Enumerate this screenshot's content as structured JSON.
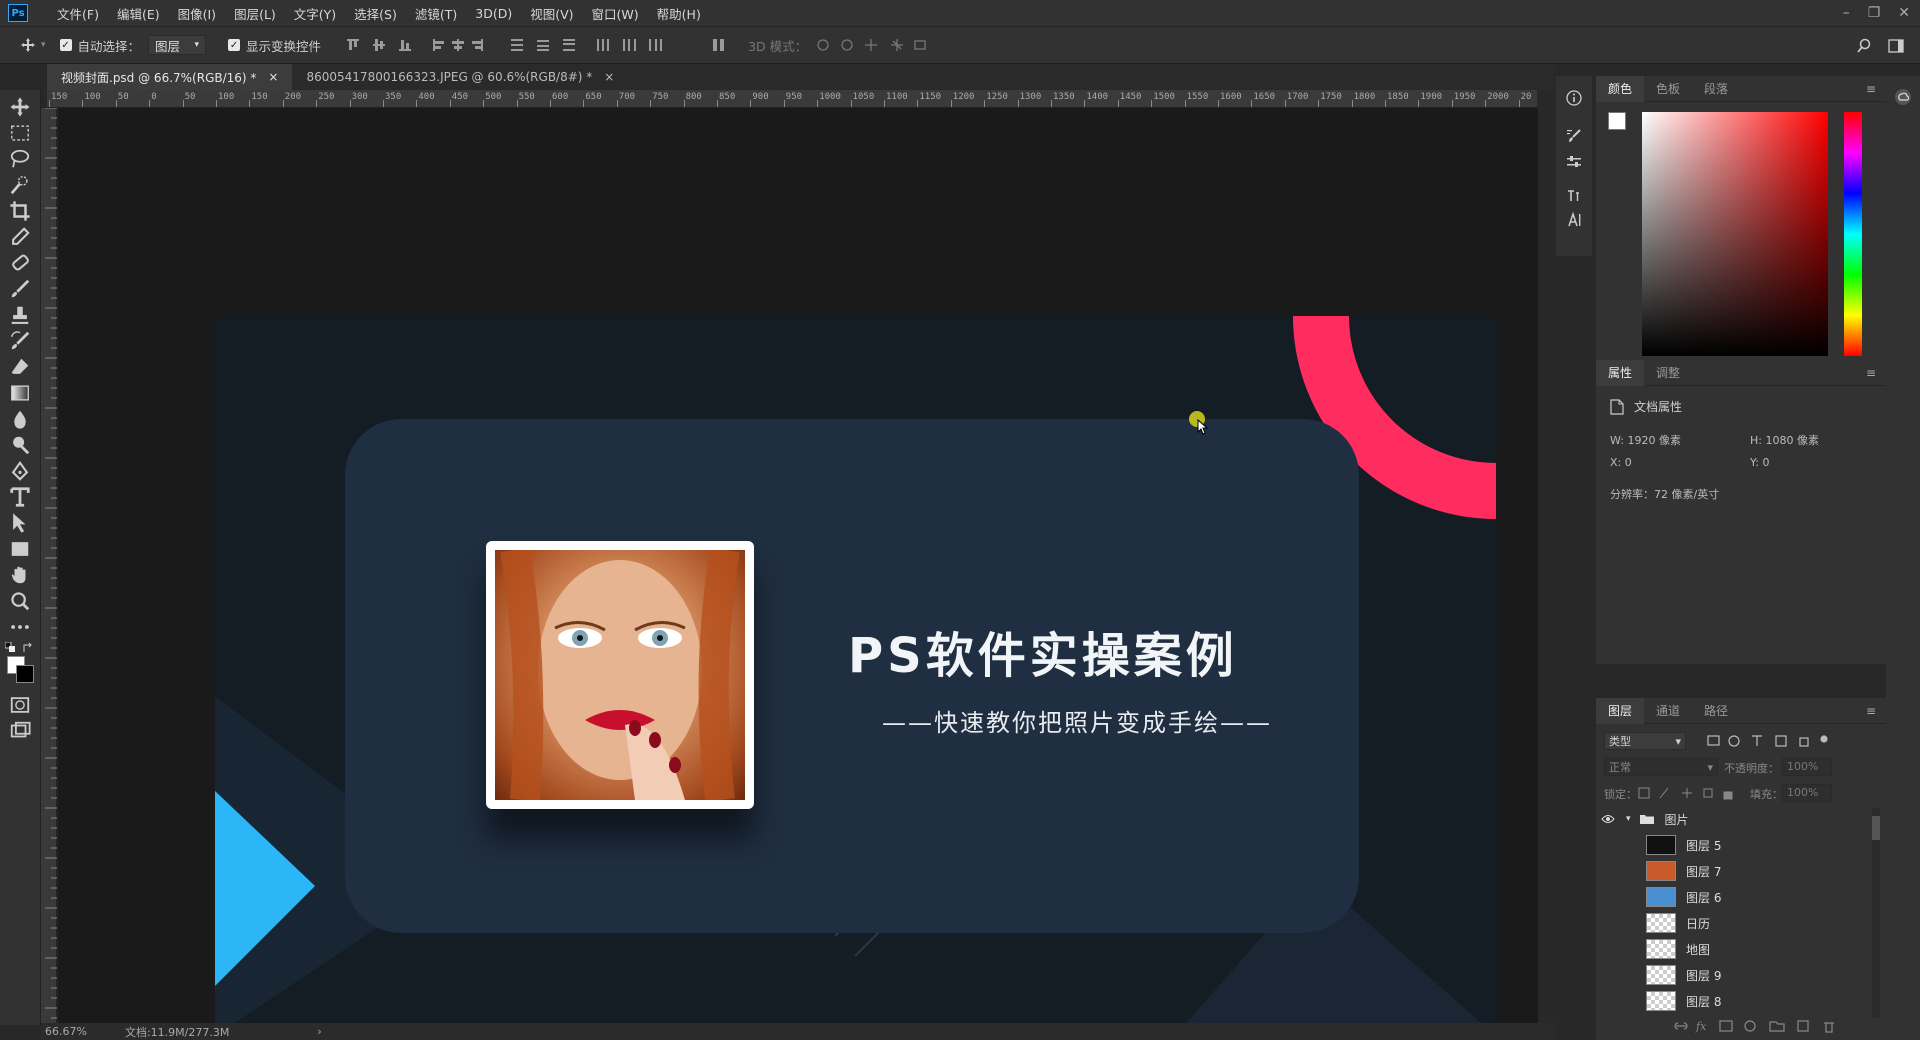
{
  "app": {
    "logo": "Ps"
  },
  "menu": [
    "文件(F)",
    "编辑(E)",
    "图像(I)",
    "图层(L)",
    "文字(Y)",
    "选择(S)",
    "滤镜(T)",
    "3D(D)",
    "视图(V)",
    "窗口(W)",
    "帮助(H)"
  ],
  "window_controls": {
    "minimize": "–",
    "restore": "❐",
    "close": "✕"
  },
  "options": {
    "auto_select_label": "自动选择：",
    "auto_select_target": "图层",
    "show_transform_label": "显示变换控件",
    "mode_3d_label": "3D 模式："
  },
  "tabs": [
    {
      "label": "视频封面.psd @ 66.7%(RGB/16) *",
      "close": "×"
    },
    {
      "label": "860054178001663​23.JPEG @ 60.6%(RGB/8#) *",
      "close": "×"
    }
  ],
  "ruler_ticks": [
    "150",
    "100",
    "50",
    "0",
    "50",
    "100",
    "150",
    "200",
    "250",
    "300",
    "350",
    "400",
    "450",
    "500",
    "550",
    "600",
    "650",
    "700",
    "750",
    "800",
    "850",
    "900",
    "950",
    "1000",
    "1050",
    "1100",
    "1150",
    "1200",
    "1250",
    "1300",
    "1350",
    "1400",
    "1450",
    "1500",
    "1550",
    "1600",
    "1650",
    "1700",
    "1750",
    "1800",
    "1850",
    "1900",
    "1950",
    "2000",
    "20"
  ],
  "artwork": {
    "headline": "PS软件实操案例",
    "subline": "——快速教你把照片变成手绘——"
  },
  "color_panel": {
    "tabs": [
      "颜色",
      "色板",
      "段落"
    ]
  },
  "properties_panel": {
    "tabs": [
      "属性",
      "调整"
    ],
    "section": "文档属性",
    "w_label": "W:",
    "w_value": "1920 像素",
    "h_label": "H:",
    "h_value": "1080 像素",
    "x_label": "X:",
    "x_value": "0",
    "y_label": "Y:",
    "y_value": "0",
    "resolution": "分辨率：72 像素/英寸"
  },
  "layers_panel": {
    "tabs": [
      "图层",
      "通道",
      "路径"
    ],
    "filter": "类型",
    "blend_mode": "正常",
    "opacity_label": "不透明度：",
    "opacity_value": "100%",
    "lock_label": "锁定：",
    "fill_label": "填充：",
    "fill_value": "100%",
    "group": "图片",
    "layers": [
      "图层 5",
      "图层 7",
      "图层 6",
      "日历",
      "地图",
      "图层 9",
      "图层 8"
    ]
  },
  "status": {
    "zoom": "66.67%",
    "doc": "文档:11.9M/277.3M",
    "arrow": "›"
  },
  "colors": {
    "accent_pink": "#ff2d5f",
    "accent_blue": "#2bb7f7",
    "card": "#1f2e40",
    "artboard": "#141c24"
  }
}
